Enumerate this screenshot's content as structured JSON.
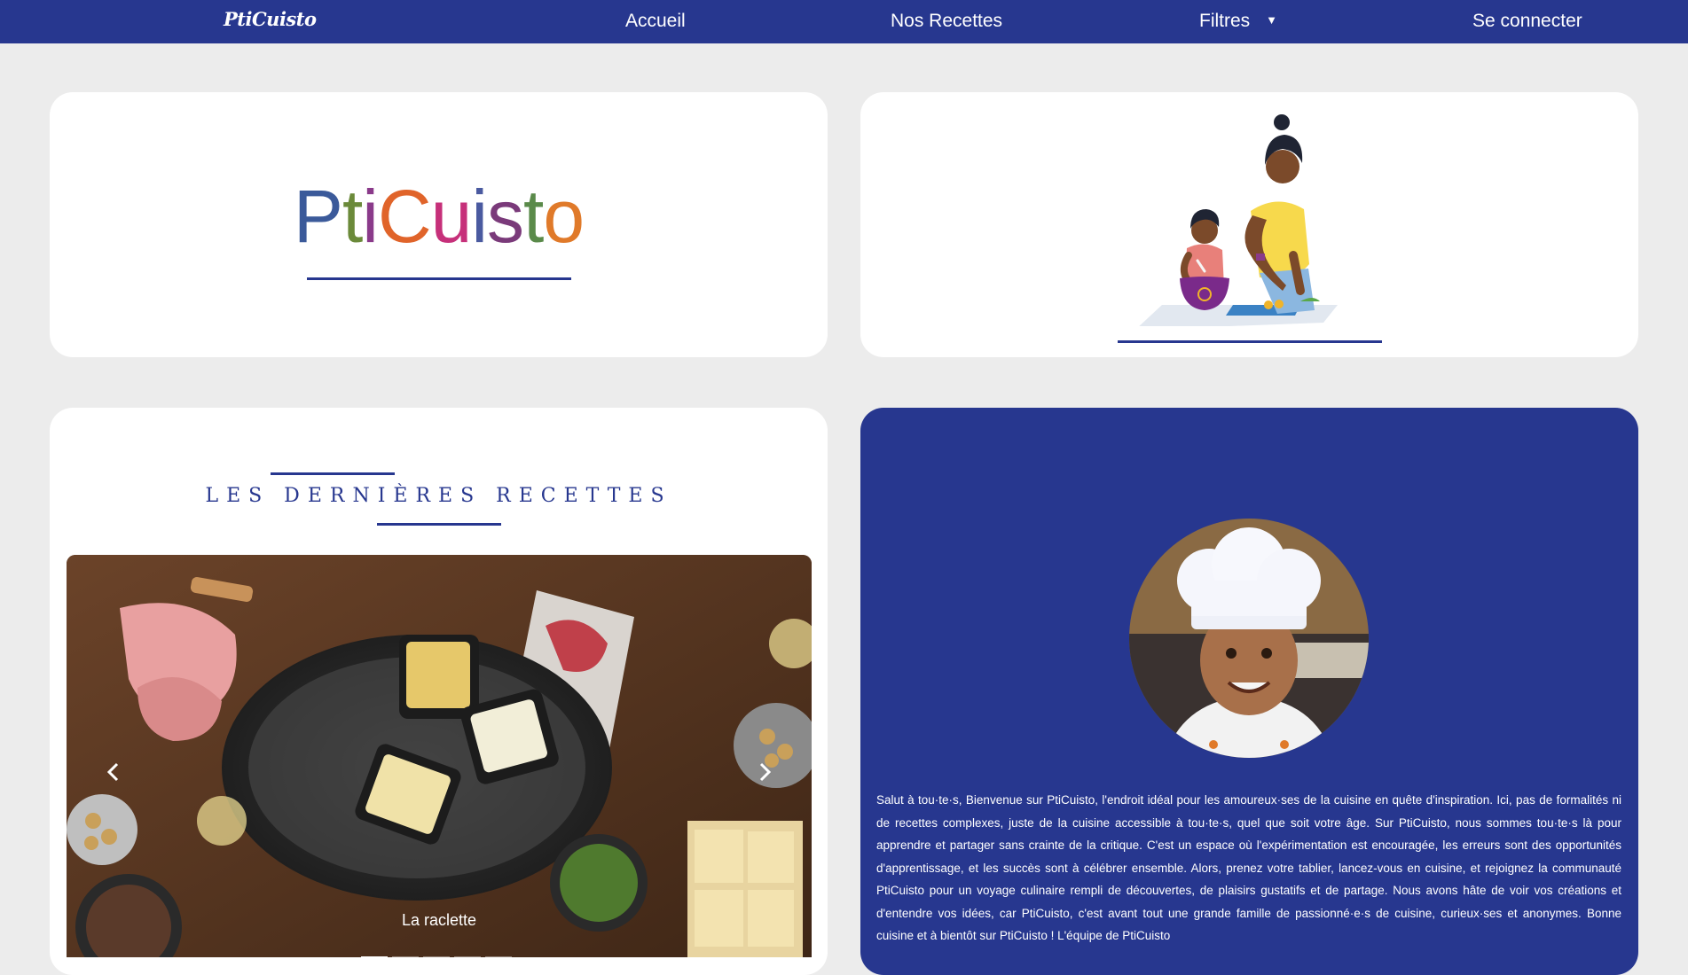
{
  "nav": {
    "logo": "PtiCuisto",
    "links": [
      "Accueil",
      "Nos Recettes",
      "Filtres",
      "Se connecter"
    ],
    "filter_caret": "▼"
  },
  "hero": {
    "logo_letters": [
      "P",
      "t",
      "i",
      "C",
      "u",
      "i",
      "s",
      "t",
      "o"
    ],
    "logo_colors": [
      "#3b5a9a",
      "#6b8a3a",
      "#8a3a8a",
      "#e0642a",
      "#c6307a",
      "#4a5aa0",
      "#7a3a7a",
      "#5a8a4a",
      "#e07a2a"
    ],
    "illustration": "mother-and-child-cooking-illustration"
  },
  "recipes": {
    "title": "Les dernières recettes",
    "caption": "La raclette",
    "prev_icon": "chevron-left-icon",
    "next_icon": "chevron-right-icon",
    "slide_count": 5,
    "active_slide": 0
  },
  "about": {
    "avatar": "child-chef-avatar",
    "text": "Salut à tou·te·s, Bienvenue sur PtiCuisto, l'endroit idéal pour les amoureux·ses de la cuisine en quête d'inspiration. Ici, pas de formalités ni de recettes complexes, juste de la cuisine accessible à tou·te·s, quel que soit votre âge. Sur PtiCuisto, nous sommes tou·te·s là pour apprendre et partager sans crainte de la critique. C'est un espace où l'expérimentation est encouragée, les erreurs sont des opportunités d'apprentissage, et les succès sont à célébrer ensemble. Alors, prenez votre tablier, lancez-vous en cuisine, et rejoignez la communauté PtiCuisto pour un voyage culinaire rempli de découvertes, de plaisirs gustatifs et de partage. Nous avons hâte de voir vos créations et d'entendre vos idées, car PtiCuisto, c'est avant tout une grande famille de passionné·e·s de cuisine, curieux·ses et anonymes. Bonne cuisine et à bientôt sur PtiCuisto ! L'équipe de PtiCuisto"
  },
  "colors": {
    "brand": "#27378f",
    "background": "#ececec"
  }
}
